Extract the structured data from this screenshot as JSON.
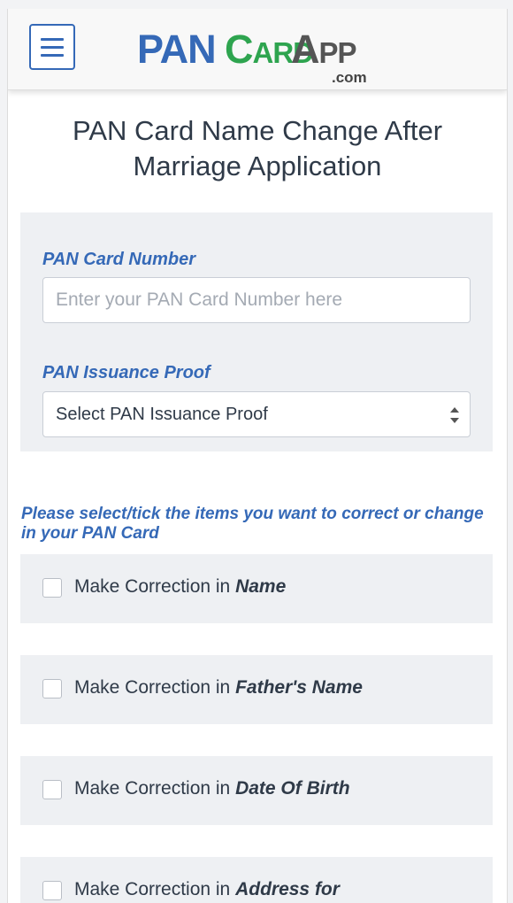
{
  "header": {
    "menu_icon": "hamburger-menu-icon",
    "logo": {
      "pan": "PAN",
      "card": "CARD",
      "app": "APP",
      "domain": ".com"
    },
    "colors": {
      "blue": "#3569b7",
      "green": "#2ea44f",
      "gray": "#555555"
    }
  },
  "page": {
    "title": "PAN Card Name Change After Marriage Application"
  },
  "form": {
    "pan_label": "PAN Card Number",
    "pan_placeholder": "Enter your PAN Card Number here",
    "proof_label": "PAN Issuance Proof",
    "proof_selected": "Select PAN Issuance Proof"
  },
  "corrections": {
    "instruction": "Please select/tick the items you want to correct or change in your PAN Card",
    "prefix": "Make Correction in",
    "items": [
      {
        "field": "Name",
        "checked": false
      },
      {
        "field": "Father's Name",
        "checked": false
      },
      {
        "field": "Date Of Birth",
        "checked": false
      },
      {
        "field": "Address for",
        "checked": false
      }
    ]
  }
}
